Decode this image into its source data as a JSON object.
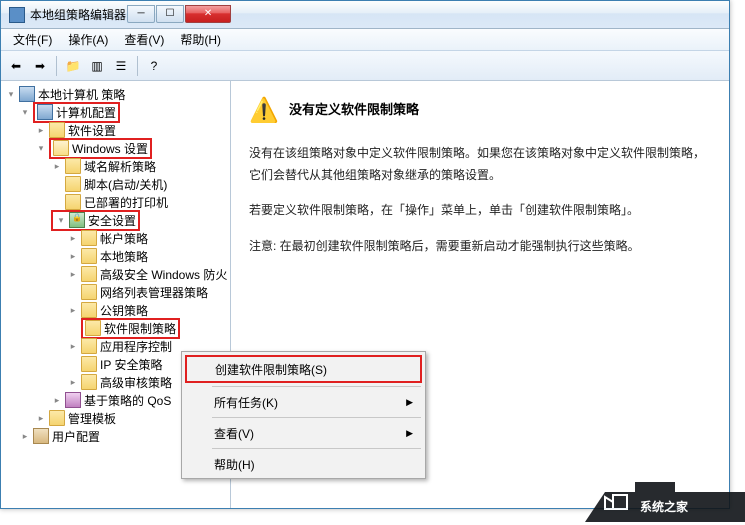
{
  "window": {
    "title": "本地组策略编辑器"
  },
  "menubar": [
    {
      "label": "文件(F)"
    },
    {
      "label": "操作(A)"
    },
    {
      "label": "查看(V)"
    },
    {
      "label": "帮助(H)"
    }
  ],
  "tree": {
    "root": "本地计算机 策略",
    "computer_config": "计算机配置",
    "software_settings": "软件设置",
    "windows_settings": "Windows 设置",
    "dns_policy": "域名解析策略",
    "scripts": "脚本(启动/关机)",
    "deployed_printers": "已部署的打印机",
    "security_settings": "安全设置",
    "account_policy": "帐户策略",
    "local_policy": "本地策略",
    "adv_firewall": "高级安全 Windows 防火",
    "network_list": "网络列表管理器策略",
    "public_key": "公钥策略",
    "software_restrict": "软件限制策略",
    "app_control": "应用程序控制",
    "ip_security": "IP 安全策略",
    "adv_audit": "高级审核策略",
    "qos": "基于策略的 QoS",
    "admin_templates": "管理模板",
    "user_config": "用户配置"
  },
  "details": {
    "title": "没有定义软件限制策略",
    "p1": "没有在该组策略对象中定义软件限制策略。如果您在该策略对象中定义软件限制策略，它们会替代从其他组策略对象继承的策略设置。",
    "p2": "若要定义软件限制策略，在「操作」菜单上，单击「创建软件限制策略」。",
    "p3": "注意: 在最初创建软件限制策略后，需要重新启动才能强制执行这些策略。"
  },
  "context_menu": {
    "create": "创建软件限制策略(S)",
    "all_tasks": "所有任务(K)",
    "view": "查看(V)",
    "help": "帮助(H)"
  }
}
